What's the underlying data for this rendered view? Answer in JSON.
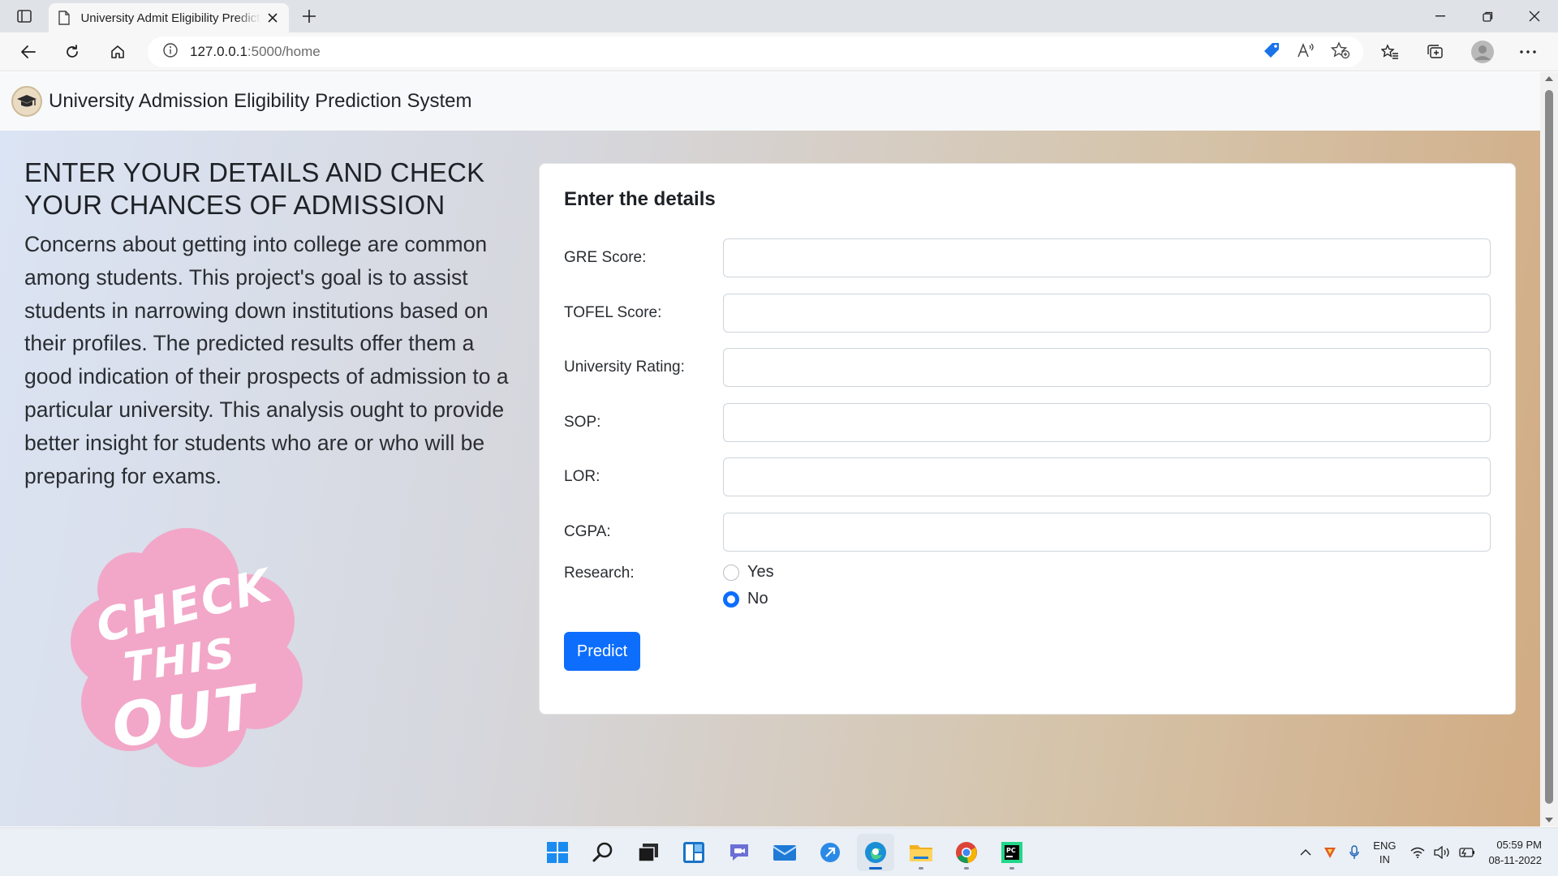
{
  "browser": {
    "tab_title": "University Admit Eligibility Predictor",
    "url_host": "127.0.0.1",
    "url_path": ":5000/home",
    "icons": [
      "tab-actions-icon",
      "document-icon",
      "close-icon",
      "plus-icon",
      "minimize-icon",
      "restore-icon",
      "window-close-icon",
      "back-icon",
      "refresh-icon",
      "home-icon",
      "info-icon",
      "tag-icon",
      "read-aloud-icon",
      "add-favorite-icon",
      "favorites-icon",
      "collections-icon",
      "profile-icon",
      "more-icon"
    ]
  },
  "navbar": {
    "brand": "University Admission Eligibility Prediction System",
    "logo_icon": "graduation-cap-icon"
  },
  "left": {
    "heading": "ENTER YOUR DETAILS AND CHECK YOUR CHANCES OF ADMISSION",
    "body": "Concerns about getting into college are common among students. This project's goal is to assist students in narrowing down institutions based on their profiles. The predicted results offer them a good indication of their prospects of admission to a particular university. This analysis ought to provide better insight for students who are or who will be preparing for exams.",
    "sticker_text": "CHECK THIS OUT"
  },
  "form": {
    "title": "Enter the details",
    "fields": [
      {
        "label": "GRE Score:",
        "value": ""
      },
      {
        "label": "TOFEL Score:",
        "value": ""
      },
      {
        "label": "University Rating:",
        "value": ""
      },
      {
        "label": "SOP:",
        "value": ""
      },
      {
        "label": "LOR:",
        "value": ""
      },
      {
        "label": "CGPA:",
        "value": ""
      }
    ],
    "research": {
      "label": "Research:",
      "options": [
        "Yes",
        "No"
      ],
      "selected": "No"
    },
    "submit_label": "Predict"
  },
  "taskbar": {
    "lang_line1": "ENG",
    "lang_line2": "IN",
    "time": "05:59 PM",
    "date": "08-11-2022",
    "apps": [
      "windows-start-icon",
      "search-icon",
      "task-view-icon",
      "widgets-icon",
      "teams-chat-icon",
      "mail-icon",
      "app-icon",
      "edge-icon",
      "file-explorer-icon",
      "chrome-icon",
      "pycharm-icon"
    ]
  },
  "colors": {
    "primary": "#0d6efd",
    "sticker_pink": "#f2a7c8",
    "gradient_start": "#dbe4f4",
    "gradient_end": "#d1ab82"
  }
}
